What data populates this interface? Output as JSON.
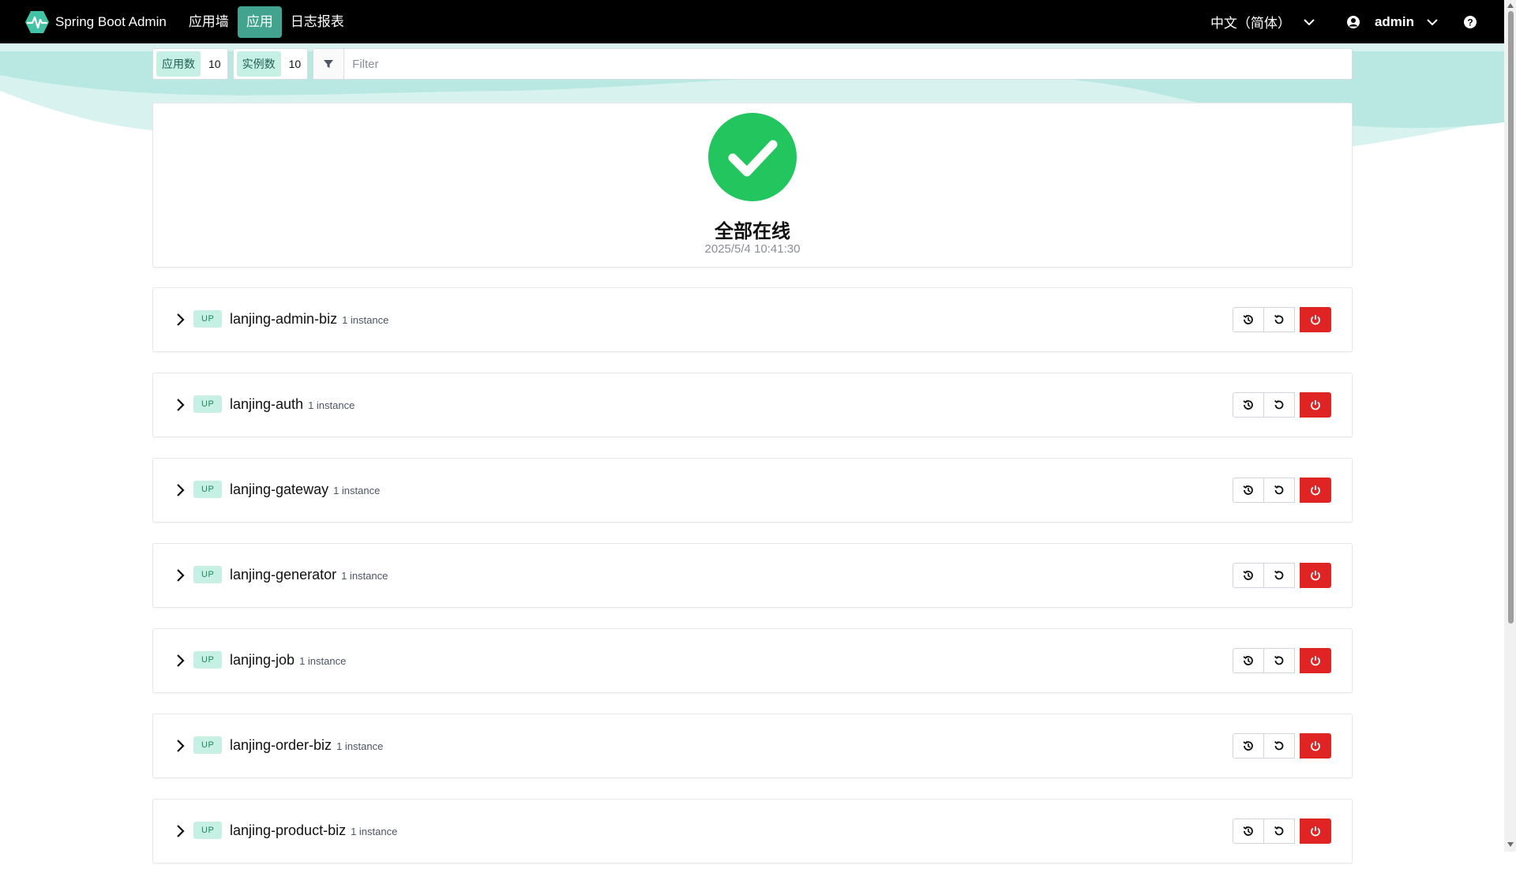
{
  "navbar": {
    "brand": "Spring Boot Admin",
    "items": [
      {
        "label": "应用墙"
      },
      {
        "label": "应用"
      },
      {
        "label": "日志报表"
      }
    ],
    "language": "中文（简体）",
    "user": "admin"
  },
  "toolbar": {
    "apps_label": "应用数",
    "apps_count": "10",
    "instances_label": "实例数",
    "instances_count": "10",
    "filter_placeholder": "Filter"
  },
  "status": {
    "title": "全部在线",
    "timestamp": "2025/5/4 10:41:30"
  },
  "applications": [
    {
      "status": "UP",
      "name": "lanjing-admin-biz",
      "instances": "1 instance"
    },
    {
      "status": "UP",
      "name": "lanjing-auth",
      "instances": "1 instance"
    },
    {
      "status": "UP",
      "name": "lanjing-gateway",
      "instances": "1 instance"
    },
    {
      "status": "UP",
      "name": "lanjing-generator",
      "instances": "1 instance"
    },
    {
      "status": "UP",
      "name": "lanjing-job",
      "instances": "1 instance"
    },
    {
      "status": "UP",
      "name": "lanjing-order-biz",
      "instances": "1 instance"
    },
    {
      "status": "UP",
      "name": "lanjing-product-biz",
      "instances": "1 instance"
    }
  ],
  "colors": {
    "accent": "#42a38e",
    "success": "#22c55e",
    "danger": "#e02424",
    "badge_bg": "#c6f0e4"
  },
  "icons": {
    "brand": "heartbeat-icon",
    "language": "chevron-down-icon",
    "user": "user-circle-icon",
    "help": "question-circle-icon",
    "filter": "filter-icon",
    "status": "check-circle-icon",
    "row_expand": "chevron-right-icon",
    "row_actions": [
      "history-icon",
      "refresh-icon",
      "power-icon"
    ]
  }
}
